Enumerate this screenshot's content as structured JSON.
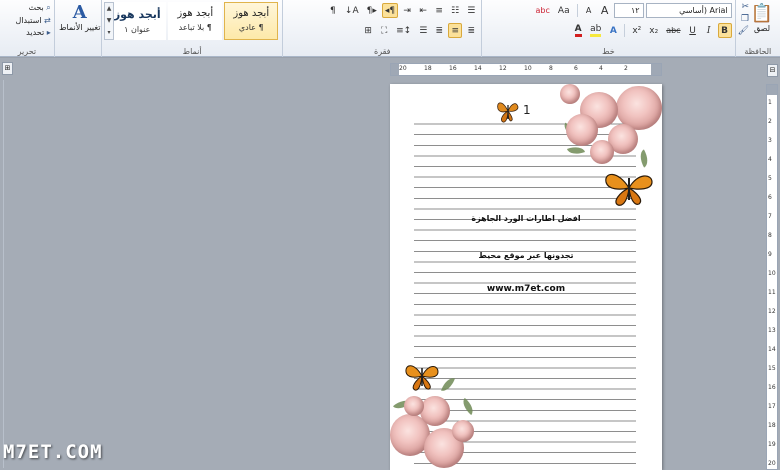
{
  "ribbon": {
    "groups": {
      "clipboard": "الحافظة",
      "font": "خط",
      "paragraph": "فقرة",
      "styles": "أنماط",
      "editing": "تحرير"
    },
    "clipboard": {
      "paste": "لصق"
    },
    "font": {
      "name": "Arial (أساسي",
      "size": "١٢",
      "grow": "A",
      "shrink": "A",
      "change_case": "Aa",
      "clear": "abc",
      "bold": "B",
      "italic": "I",
      "underline": "U",
      "strike": "abc",
      "subscript": "x₂",
      "superscript": "x²",
      "text_color": "A",
      "highlight": "ab"
    },
    "paragraph": {
      "show_marks": "¶",
      "sort": "A↓",
      "rtl": "¶◂",
      "ltr": "▸¶"
    },
    "styles": {
      "items": [
        {
          "sample": "أبجد هوز",
          "name": "¶ عادي"
        },
        {
          "sample": "أبجد هوز",
          "name": "¶ بلا تباعد"
        },
        {
          "sample": "أبجد هوز",
          "name": "عنوان ١"
        }
      ],
      "change_styles": "تغيير الأنماط"
    },
    "editing": {
      "find": "بحث",
      "replace": "استبدال",
      "select": "تحديد"
    }
  },
  "ruler": {
    "horizontal_ticks": [
      "20",
      "18",
      "16",
      "14",
      "12",
      "10",
      "8",
      "6",
      "4",
      "2"
    ],
    "vertical_ticks": [
      "1",
      "2",
      "3",
      "4",
      "5",
      "6",
      "7",
      "8",
      "9",
      "10",
      "11",
      "12",
      "13",
      "14",
      "15",
      "16",
      "17",
      "18",
      "19",
      "20"
    ]
  },
  "document": {
    "page_number": "1",
    "line1": "افضل اطارات الورد الجاهزة",
    "line2": "تجدونها عبر موقع محيط",
    "url": "www.m7et.com"
  },
  "watermark": "M7ET.COM",
  "colors": {
    "ribbon_bg": "#e7ecf3",
    "workspace": "#a5acb6",
    "selected": "#fbe19a",
    "text_color_red": "#d21f1f",
    "highlight_yellow": "#f6e93c"
  }
}
